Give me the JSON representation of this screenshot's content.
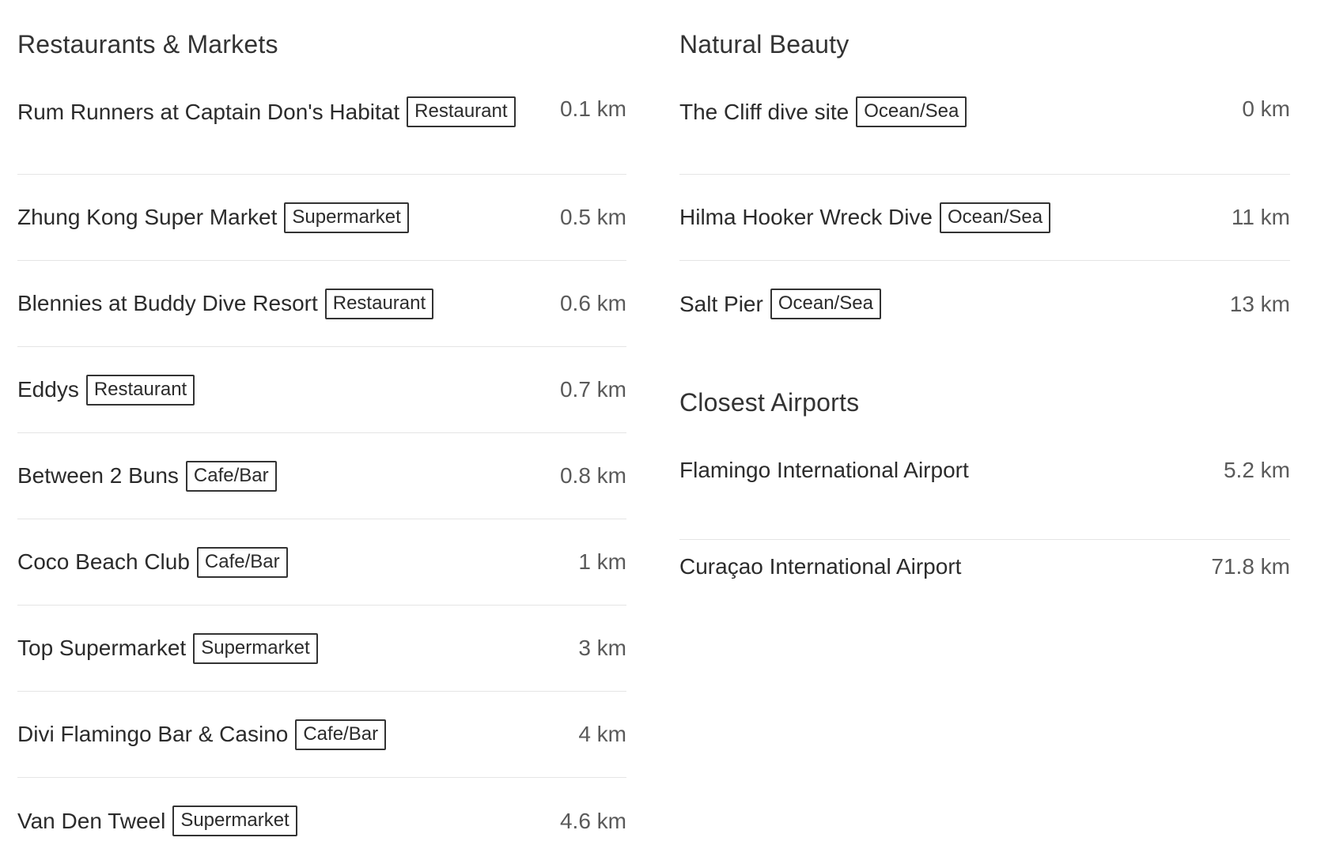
{
  "restaurants": {
    "title": "Restaurants & Markets",
    "items": [
      {
        "name": "Rum Runners at Captain Don's Habitat",
        "tag": "Restaurant",
        "distance": "0.1 km"
      },
      {
        "name": "Zhung Kong Super Market",
        "tag": "Supermarket",
        "distance": "0.5 km"
      },
      {
        "name": "Blennies at Buddy Dive Resort",
        "tag": "Restaurant",
        "distance": "0.6 km"
      },
      {
        "name": "Eddys",
        "tag": "Restaurant",
        "distance": "0.7 km"
      },
      {
        "name": "Between 2 Buns",
        "tag": "Cafe/Bar",
        "distance": "0.8 km"
      },
      {
        "name": "Coco Beach Club",
        "tag": "Cafe/Bar",
        "distance": "1 km"
      },
      {
        "name": "Top Supermarket",
        "tag": "Supermarket",
        "distance": "3 km"
      },
      {
        "name": "Divi Flamingo Bar & Casino",
        "tag": "Cafe/Bar",
        "distance": "4 km"
      },
      {
        "name": "Van Den Tweel",
        "tag": "Supermarket",
        "distance": "4.6 km"
      }
    ]
  },
  "natural_beauty": {
    "title": "Natural Beauty",
    "items": [
      {
        "name": "The Cliff dive site",
        "tag": "Ocean/Sea",
        "distance": "0 km"
      },
      {
        "name": "Hilma Hooker Wreck Dive",
        "tag": "Ocean/Sea",
        "distance": "11 km"
      },
      {
        "name": "Salt Pier",
        "tag": "Ocean/Sea",
        "distance": "13 km"
      }
    ]
  },
  "airports": {
    "title": "Closest Airports",
    "items": [
      {
        "name": "Flamingo International Airport",
        "distance": "5.2 km"
      },
      {
        "name": "Curaçao International Airport",
        "distance": "71.8 km"
      }
    ]
  }
}
